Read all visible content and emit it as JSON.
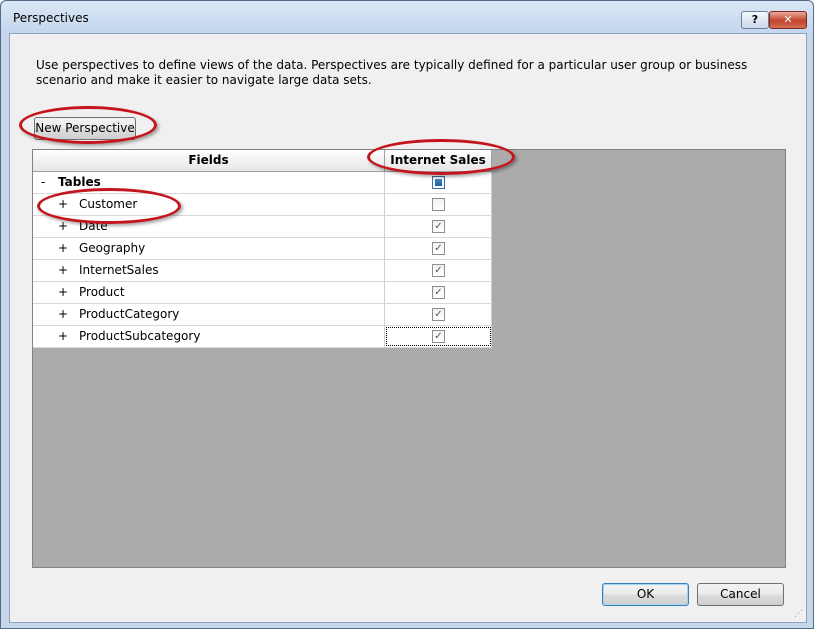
{
  "window": {
    "title": "Perspectives",
    "help_label": "?",
    "close_label": "✕"
  },
  "description": "Use perspectives to define views of the data. Perspectives are typically defined for a particular user group or business scenario and make it easier to navigate large data sets.",
  "buttons": {
    "new_perspective": "New Perspective",
    "ok": "OK",
    "cancel": "Cancel"
  },
  "grid": {
    "columns": [
      "Fields",
      "Internet Sales"
    ],
    "parent": {
      "expander": "-",
      "name": "Tables",
      "check_state": "indeterminate"
    },
    "rows": [
      {
        "expander": "+",
        "name": "Customer",
        "checked": false
      },
      {
        "expander": "+",
        "name": "Date",
        "checked": true
      },
      {
        "expander": "+",
        "name": "Geography",
        "checked": true
      },
      {
        "expander": "+",
        "name": "InternetSales",
        "checked": true
      },
      {
        "expander": "+",
        "name": "Product",
        "checked": true
      },
      {
        "expander": "+",
        "name": "ProductCategory",
        "checked": true
      },
      {
        "expander": "+",
        "name": "ProductSubcategory",
        "checked": true
      }
    ]
  },
  "colors": {
    "annotation": "#c4151c",
    "grid_background": "#ababab"
  }
}
